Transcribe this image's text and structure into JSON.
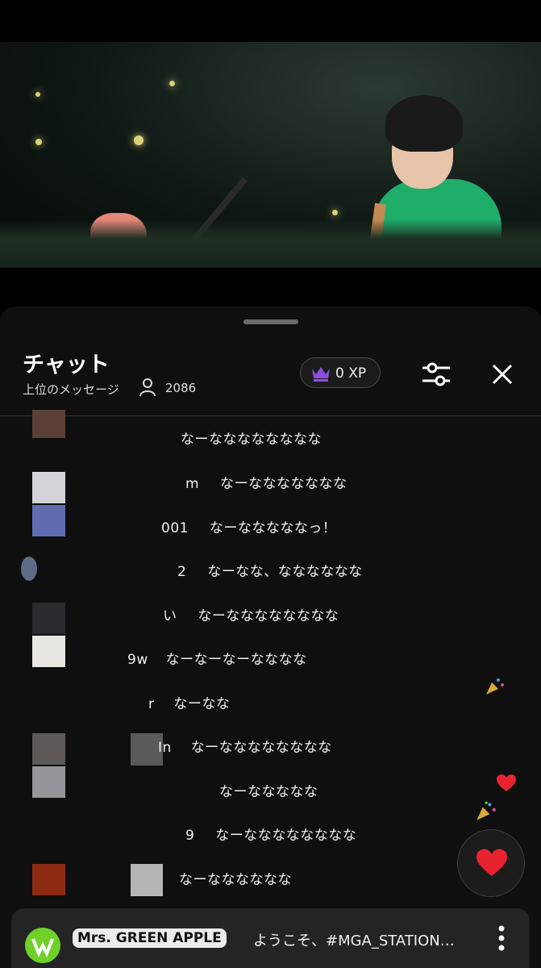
{
  "header": {
    "title": "チャット",
    "subtitle": "上位のメッセージ",
    "viewer_count": "2086",
    "xp_label": "0 XP"
  },
  "messages": [
    {
      "name_tail": "",
      "text": "なーなななななななな"
    },
    {
      "name_tail": "m",
      "text": "なーななななななな"
    },
    {
      "name_tail": "001",
      "text": "なーなななななっ！"
    },
    {
      "name_tail": "2",
      "text": "なーなな、なななななな"
    },
    {
      "name_tail": "い",
      "text": "なーなななななななな"
    },
    {
      "name_tail": "9w",
      "text": "なーなーなーなななな"
    },
    {
      "name_tail": "r",
      "text": "なーなな"
    },
    {
      "name_tail": "In",
      "text": "なーなななななななな"
    },
    {
      "name_tail": "",
      "text": "なーななななな"
    },
    {
      "name_tail": "9",
      "text": "なーなななななななな"
    },
    {
      "name_tail": "",
      "text": "なーなななななな"
    }
  ],
  "banner": {
    "channel": "Mrs. GREEN APPLE",
    "message": "ようこそ、#MGA_STATION…"
  },
  "icons": {
    "viewer": "person-icon",
    "xp": "crown-icon",
    "filter": "sliders-icon",
    "close": "close-icon",
    "heart": "heart-icon",
    "more": "more-vertical-icon",
    "reactions": [
      "party-popper-icon",
      "heart-icon",
      "party-popper-icon"
    ]
  },
  "colors": {
    "panel_bg": "#0f0f0f",
    "crown": "#8b4fe0",
    "heart": "#e8232f",
    "logo": "#6fd12a"
  }
}
